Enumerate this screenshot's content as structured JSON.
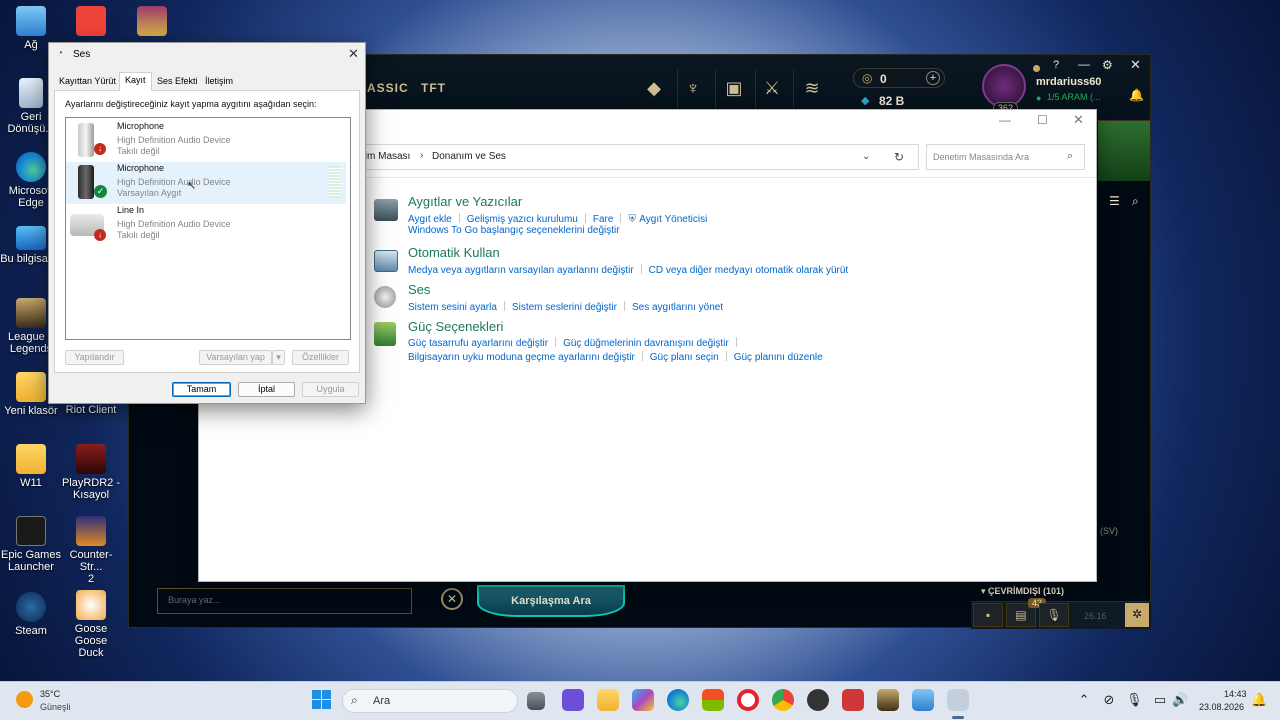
{
  "desktop": {
    "icons": [
      {
        "label": "Ağ",
        "name": "network-icon"
      },
      {
        "label": "Geri\nDönüşü...",
        "name": "recycle-bin-icon"
      },
      {
        "label": "Microsoft\nEdge",
        "name": "edge-icon"
      },
      {
        "label": "Bu bilgisay...",
        "name": "this-pc-icon"
      },
      {
        "label": "League o\nLegends",
        "name": "league-of-legends-icon"
      },
      {
        "label": "Yeni klasör",
        "name": "new-folder-icon"
      },
      {
        "label": "W11",
        "name": "folder-w11-icon"
      },
      {
        "label": "Epic Games\nLauncher",
        "name": "epic-games-icon"
      },
      {
        "label": "Steam",
        "name": "steam-icon"
      },
      {
        "label": "Riot Client",
        "name": "riot-client-icon"
      },
      {
        "label": "PlayRDR2 -\nKısayol",
        "name": "rdr2-icon"
      },
      {
        "label": "Counter-Str...\n2",
        "name": "counter-strike-icon"
      },
      {
        "label": "Goose Goose\nDuck",
        "name": "goose-goose-duck-icon"
      }
    ]
  },
  "league": {
    "nav_classic": "ASSIC",
    "nav_tft": "TFT",
    "rp": "0",
    "be": "82 B",
    "username": "mrdariuss60",
    "status": "1/5 ARAM (...",
    "level": "362",
    "chat_placeholder": "Buraya yaz...",
    "find_match": "Karşılaşma Ara",
    "offline": "ÇEVRİMDIŞI (101)",
    "sv": "(SV)",
    "badge": "43",
    "version": "26.16"
  },
  "control_panel": {
    "breadcrumb_1": "tim Masası",
    "breadcrumb_sep": "›",
    "breadcrumb_2": "Donanım ve Ses",
    "search_placeholder": "Denetim Masasında Ara",
    "categories": [
      {
        "title": "Aygıtlar ve Yazıcılar",
        "links": [
          "Aygıt ekle",
          "Gelişmiş yazıcı kurulumu",
          "Fare",
          "Aygıt Yöneticisi",
          "Windows To Go başlangıç seçeneklerini değiştir"
        ]
      },
      {
        "title": "Otomatik Kullan",
        "links": [
          "Medya veya aygıtların varsayılan ayarlarını değiştir",
          "CD veya diğer medyayı otomatik olarak yürüt"
        ]
      },
      {
        "title": "Ses",
        "links": [
          "Sistem sesini ayarla",
          "Sistem seslerini değiştir",
          "Ses aygıtlarını yönet"
        ]
      },
      {
        "title": "Güç Seçenekleri",
        "links": [
          "Güç tasarrufu ayarlarını değiştir",
          "Güç düğmelerinin davranışını değiştir",
          "Bilgisayarın uyku moduna geçme ayarlarını değiştir",
          "Güç planı seçin",
          "Güç planını düzenle"
        ]
      }
    ]
  },
  "sound_dialog": {
    "title": "Ses",
    "tabs": [
      "Kayıttan Yürüt",
      "Kayıt",
      "Ses Efekti",
      "İletişim"
    ],
    "active_tab": "Kayıt",
    "instruction": "Ayarlarını değiştireceğiniz kayıt yapma aygıtını aşağıdan seçin:",
    "devices": [
      {
        "name": "Microphone",
        "driver": "High Definition Audio Device",
        "status": "Takılı değil"
      },
      {
        "name": "Microphone",
        "driver": "High Definition Audio Device",
        "status": "Varsayılan Aygıt"
      },
      {
        "name": "Line In",
        "driver": "High Definition Audio Device",
        "status": "Takılı değil"
      }
    ],
    "btn_configure": "Yapılandır",
    "btn_set_default": "Varsayılan yap",
    "btn_properties": "Özellikler",
    "btn_ok": "Tamam",
    "btn_cancel": "İptal",
    "btn_apply": "Uygula"
  },
  "taskbar": {
    "weather_temp": "35°C",
    "weather_desc": "Güneşli",
    "search": "Ara",
    "time": "14:43",
    "date": "23.08.2026"
  },
  "colors": {
    "link": "#0066cc",
    "category": "#1a7b56",
    "lol_gold": "#cdbe91",
    "default_ok": "#0067c0"
  }
}
